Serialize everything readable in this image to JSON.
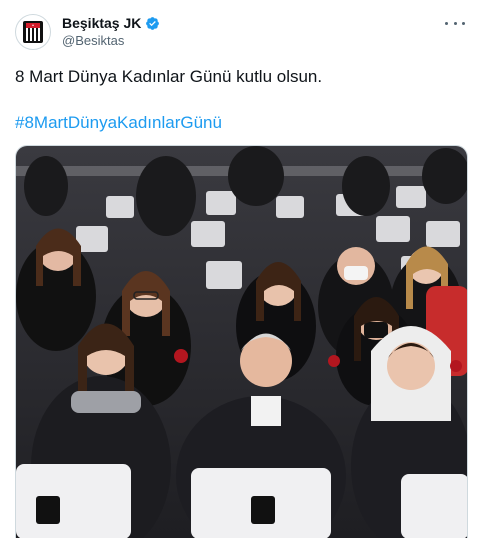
{
  "tweet": {
    "display_name": "Beşiktaş JK",
    "handle": "@Besiktas",
    "verified": true,
    "text": "8 Mart Dünya Kadınlar Günü kutlu olsun.",
    "hashtag": "#8MartDünyaKadınlarGünü"
  },
  "icons": {
    "avatar": "besiktas-crest-icon",
    "verified": "verified-badge-icon",
    "more": "more-options-icon"
  },
  "colors": {
    "link": "#1d9bf0",
    "verified": "#1d9bf0",
    "text": "#0f1419",
    "secondary": "#536471"
  },
  "media": {
    "type": "photo"
  }
}
